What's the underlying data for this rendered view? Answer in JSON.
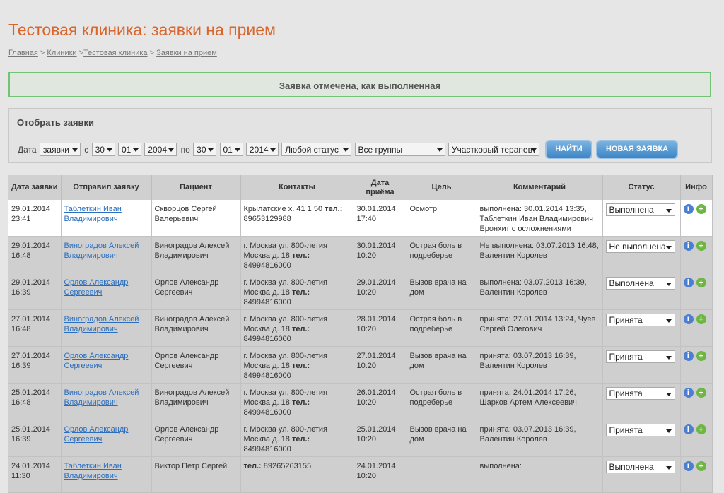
{
  "page": {
    "title": "Тестовая клиника: заявки на прием",
    "breadcrumb": [
      "Главная",
      "Клиники",
      "Тестовая клиника",
      "Заявки на прием"
    ],
    "notice": "Заявка отмечена, как выполненная"
  },
  "filter": {
    "title": "Отобрать заявки",
    "date_label": "Дата",
    "date_type": "заявки",
    "from_label": "с",
    "from": {
      "day": "30",
      "month": "01",
      "year": "2004"
    },
    "to_label": "по",
    "to": {
      "day": "30",
      "month": "01",
      "year": "2014"
    },
    "status": "Любой статус",
    "group": "Все группы",
    "doctor": "Участковый терапевт",
    "search_button": "НАЙТИ",
    "new_button": "НОВАЯ ЗАЯВКА"
  },
  "table": {
    "headers": [
      "Дата заявки",
      "Отправил заявку",
      "Пациент",
      "Контакты",
      "Дата приёма",
      "Цель",
      "Комментарий",
      "Статус",
      "Инфо"
    ],
    "contacts_phone_label": "тел.:",
    "rows": [
      {
        "date": "29.01.2014",
        "time": "23:41",
        "sender": "Таблеткин Иван Владимирович",
        "patient": "Скворцов Сергей Валерьевич",
        "address": "Крылатские х. 41 1 50",
        "phone": "89653129988",
        "appt_date": "30.01.2014",
        "appt_time": "17:40",
        "goal": "Осмотр",
        "comment": "выполнена: 30.01.2014 13:35, Таблеткин Иван Владимирович Бронхит с осложнениями",
        "status": "Выполнена"
      },
      {
        "date": "29.01.2014",
        "time": "16:48",
        "sender": "Виноградов Алексей Владимирович",
        "patient": "Виноградов Алексей Владимирович",
        "address": "г. Москва ул. 800-летия Москва д. 18",
        "phone": "84994816000",
        "appt_date": "30.01.2014",
        "appt_time": "10:20",
        "goal": "Острая боль в подреберье",
        "comment": "Не выполнена: 03.07.2013 16:48, Валентин Королев",
        "status": "Не выполнена"
      },
      {
        "date": "29.01.2014",
        "time": "16:39",
        "sender": "Орлов Александр Сергеевич",
        "patient": "Орлов Александр Сергеевич",
        "address": "г. Москва ул. 800-летия Москва д. 18",
        "phone": "84994816000",
        "appt_date": "29.01.2014",
        "appt_time": "10:20",
        "goal": "Вызов врача на дом",
        "comment": "выполнена: 03.07.2013 16:39, Валентин Королев",
        "status": "Выполнена"
      },
      {
        "date": "27.01.2014",
        "time": "16:48",
        "sender": "Виноградов Алексей Владимирович",
        "patient": "Виноградов Алексей Владимирович",
        "address": "г. Москва ул. 800-летия Москва д. 18",
        "phone": "84994816000",
        "appt_date": "28.01.2014",
        "appt_time": "10:20",
        "goal": "Острая боль в подреберье",
        "comment": "принята: 27.01.2014 13:24, Чуев Сергей Олегович",
        "status": "Принята"
      },
      {
        "date": "27.01.2014",
        "time": "16:39",
        "sender": "Орлов Александр Сергеевич",
        "patient": "Орлов Александр Сергеевич",
        "address": "г. Москва ул. 800-летия Москва д. 18",
        "phone": "84994816000",
        "appt_date": "27.01.2014",
        "appt_time": "10:20",
        "goal": "Вызов врача на дом",
        "comment": "принята: 03.07.2013 16:39, Валентин Королев",
        "status": "Принята"
      },
      {
        "date": "25.01.2014",
        "time": "16:48",
        "sender": "Виноградов Алексей Владимирович",
        "patient": "Виноградов Алексей Владимирович",
        "address": "г. Москва ул. 800-летия Москва д. 18",
        "phone": "84994816000",
        "appt_date": "26.01.2014",
        "appt_time": "10:20",
        "goal": "Острая боль в подреберье",
        "comment": "принята: 24.01.2014 17:26, Шарков Артем Алексеевич",
        "status": "Принята"
      },
      {
        "date": "25.01.2014",
        "time": "16:39",
        "sender": "Орлов Александр Сергеевич",
        "patient": "Орлов Александр Сергеевич",
        "address": "г. Москва ул. 800-летия Москва д. 18",
        "phone": "84994816000",
        "appt_date": "25.01.2014",
        "appt_time": "10:20",
        "goal": "Вызов врача на дом",
        "comment": "принята: 03.07.2013 16:39, Валентин Королев",
        "status": "Принята"
      },
      {
        "date": "24.01.2014",
        "time": "11:30",
        "sender": "Таблеткин Иван Владимирович",
        "patient": "Виктор Петр Сергей",
        "address": "",
        "phone": "89265263155",
        "appt_date": "24.01.2014",
        "appt_time": "10:20",
        "goal": "",
        "comment": "выполнена:",
        "status": "Выполнена"
      }
    ]
  }
}
